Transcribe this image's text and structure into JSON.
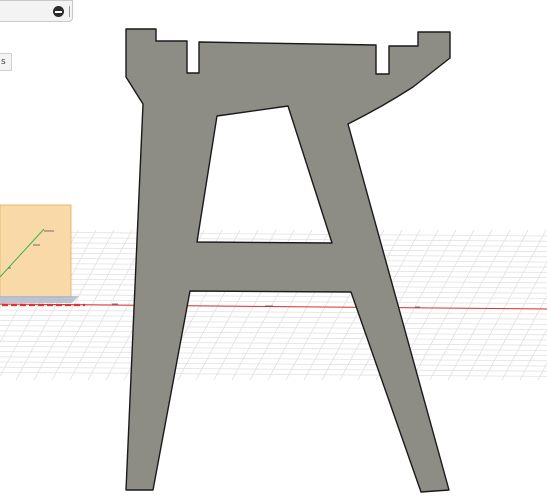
{
  "viewport": {
    "object": "table-leg-profile",
    "colors": {
      "part_fill": "#8d8d86",
      "part_outline": "#1a1a1a",
      "grid": "#e2e2e2",
      "x_axis": "#e03030",
      "y_axis": "#39b54a",
      "sketch_plane": "#f9d9a8"
    }
  },
  "toolbar": {
    "collapse_icon": "minus-circle-icon",
    "side_tab_label": "s"
  }
}
